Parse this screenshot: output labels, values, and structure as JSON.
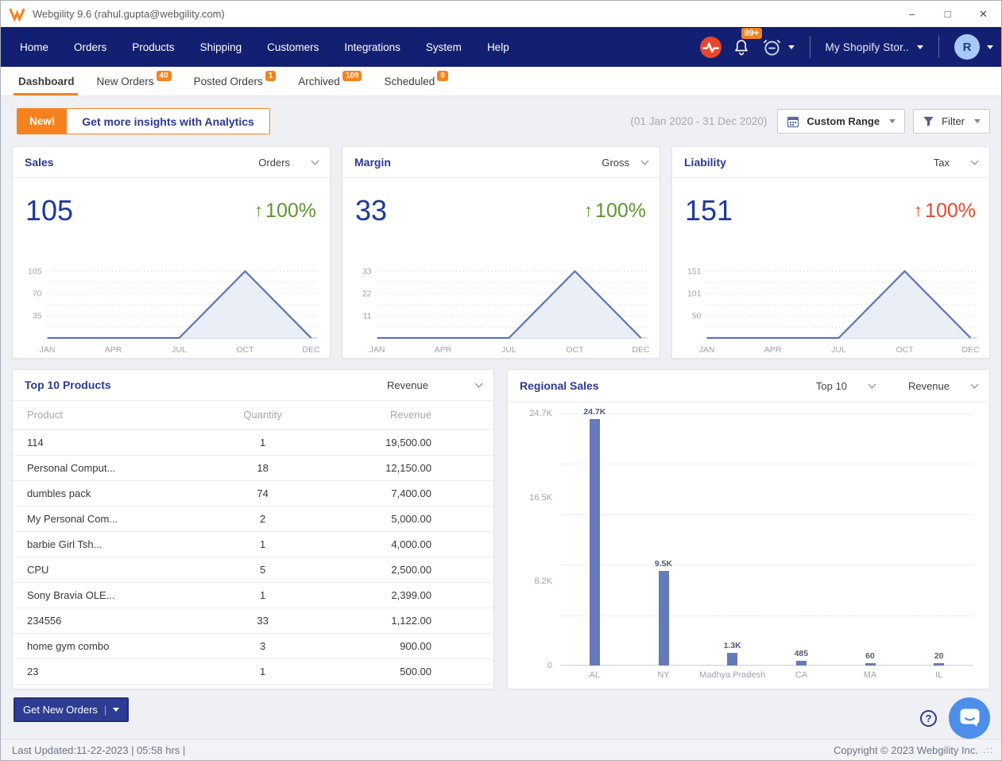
{
  "window": {
    "title": "Webgility 9.6 (rahul.gupta@webgility.com)",
    "controls": {
      "minimize": "–",
      "maximize": "□",
      "close": "✕"
    }
  },
  "navbar": {
    "items": [
      "Home",
      "Orders",
      "Products",
      "Shipping",
      "Customers",
      "Integrations",
      "System",
      "Help"
    ],
    "notification_badge": "99+",
    "store_selector_label": "My Shopify Stor..",
    "avatar_initial": "R"
  },
  "tabs": [
    {
      "label": "Dashboard",
      "badge": ""
    },
    {
      "label": "New Orders",
      "badge": "40"
    },
    {
      "label": "Posted Orders",
      "badge": "1"
    },
    {
      "label": "Archived",
      "badge": "109"
    },
    {
      "label": "Scheduled",
      "badge": "9"
    }
  ],
  "toolbar": {
    "new_badge": "New!",
    "analytics_button": "Get more insights with Analytics",
    "date_range": "(01 Jan 2020 - 31 Dec 2020)",
    "custom_range": "Custom Range",
    "filter": "Filter"
  },
  "kpis": [
    {
      "title": "Sales",
      "selector": "Orders",
      "value": "105",
      "arrow": "↑",
      "change": "100%",
      "change_color": "#5E9732"
    },
    {
      "title": "Margin",
      "selector": "Gross",
      "value": "33",
      "arrow": "↑",
      "change": "100%",
      "change_color": "#5E9732"
    },
    {
      "title": "Liability",
      "selector": "Tax",
      "value": "151",
      "arrow": "↑",
      "change": "100%",
      "change_color": "#E8472B"
    }
  ],
  "products": {
    "title": "Top 10 Products",
    "selector": "Revenue",
    "columns": [
      "Product",
      "Quantity",
      "Revenue"
    ],
    "rows": [
      [
        "114",
        "1",
        "19,500.00"
      ],
      [
        "Personal Comput...",
        "18",
        "12,150.00"
      ],
      [
        "dumbles pack",
        "74",
        "7,400.00"
      ],
      [
        "My Personal Com...",
        "2",
        "5,000.00"
      ],
      [
        "barbie Girl Tsh...",
        "1",
        "4,000.00"
      ],
      [
        "CPU",
        "5",
        "2,500.00"
      ],
      [
        "Sony Bravia OLE...",
        "1",
        "2,399.00"
      ],
      [
        "234556",
        "33",
        "1,122.00"
      ],
      [
        "home gym combo",
        "3",
        "900.00"
      ],
      [
        "23",
        "1",
        "500.00"
      ]
    ]
  },
  "regional": {
    "title": "Regional Sales",
    "selector_top": "Top 10",
    "selector_metric": "Revenue"
  },
  "chart_data": [
    {
      "type": "area",
      "name": "sales-trend",
      "x": [
        "JAN",
        "APR",
        "JUL",
        "OCT",
        "DEC"
      ],
      "series": [
        {
          "name": "Orders",
          "values": [
            0,
            0,
            0,
            105,
            0
          ]
        }
      ],
      "ylim": [
        0,
        105
      ],
      "yticks": [
        "105",
        "70",
        "35"
      ],
      "line_color": "#5B74B5",
      "fill_color": "#E9EEF7",
      "grid": "dotted"
    },
    {
      "type": "area",
      "name": "margin-trend",
      "x": [
        "JAN",
        "APR",
        "JUL",
        "OCT",
        "DEC"
      ],
      "series": [
        {
          "name": "Gross",
          "values": [
            0,
            0,
            0,
            33,
            0
          ]
        }
      ],
      "ylim": [
        0,
        33
      ],
      "yticks": [
        "33",
        "22",
        "11"
      ],
      "line_color": "#5B74B5",
      "fill_color": "#E9EEF7",
      "grid": "dotted"
    },
    {
      "type": "area",
      "name": "liability-trend",
      "x": [
        "JAN",
        "APR",
        "JUL",
        "OCT",
        "DEC"
      ],
      "series": [
        {
          "name": "Tax",
          "values": [
            0,
            0,
            0,
            151,
            0
          ]
        }
      ],
      "ylim": [
        0,
        151
      ],
      "yticks": [
        "151",
        "101",
        "50"
      ],
      "line_color": "#5B74B5",
      "fill_color": "#E9EEF7",
      "grid": "dotted"
    },
    {
      "type": "bar",
      "name": "regional-sales",
      "categories": [
        "AL",
        "NY",
        "Madhya Pradesh",
        "CA",
        "MA",
        "IL"
      ],
      "values": [
        24700,
        9500,
        1300,
        485,
        60,
        20
      ],
      "value_labels": [
        "24.7K",
        "9.5K",
        "1.3K",
        "485",
        "60",
        "20"
      ],
      "yticks": [
        "24.7K",
        "16.5K",
        "8.2K",
        "0"
      ],
      "ylim": [
        0,
        24700
      ],
      "bar_color": "#6679B8",
      "grid": "dotted",
      "legend": "none"
    }
  ],
  "footer": {
    "get_new_orders": "Get New Orders",
    "help_icon": "?",
    "last_updated": "Last Updated:11-22-2023 | 05:58 hrs |",
    "copyright": "Copyright © 2023 Webgility Inc.",
    "resize_grip": ".::"
  }
}
